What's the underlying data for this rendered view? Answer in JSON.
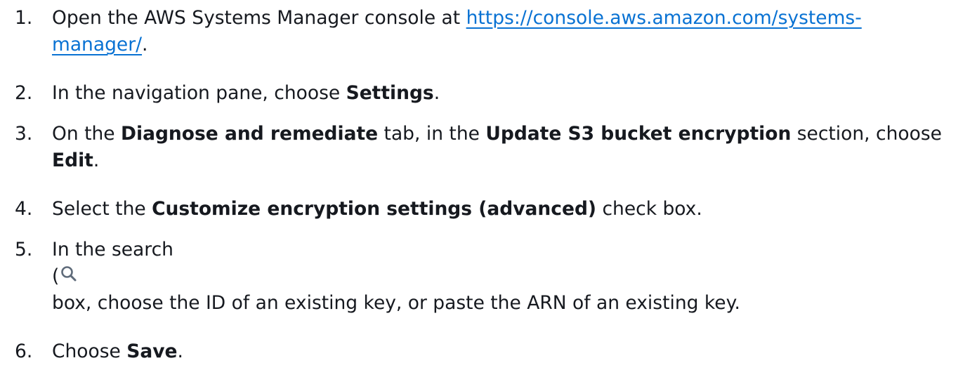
{
  "steps": [
    {
      "number": "1.",
      "text_before": "Open the AWS Systems Manager console at ",
      "link_line1": "https://console.aws.amazon.com/systems-",
      "link_line2": "manager/",
      "text_after": "."
    },
    {
      "number": "2.",
      "text_before": "In the navigation pane, choose ",
      "bold": "Settings",
      "text_after": "."
    },
    {
      "number": "3.",
      "text_before": "On the ",
      "bold1": "Diagnose and remediate",
      "text_mid": " tab, in the ",
      "bold2": "Update S3 bucket encryption",
      "text_mid2": " section, choose",
      "bold3": "Edit",
      "text_after": "."
    },
    {
      "number": "4.",
      "text_before": "Select the ",
      "bold": "Customize encryption settings (advanced)",
      "text_after": " check box."
    },
    {
      "number": "5.",
      "text_line1": "In the search",
      "paren": "(",
      "icon": "search-icon",
      "text_line3": "box, choose the ID of an existing key, or paste the ARN of an existing key."
    },
    {
      "number": "6.",
      "text_before": "Choose ",
      "bold": "Save",
      "text_after": "."
    }
  ],
  "colors": {
    "text": "#16191f",
    "link": "#0972d3",
    "icon": "#5f6b7a"
  }
}
